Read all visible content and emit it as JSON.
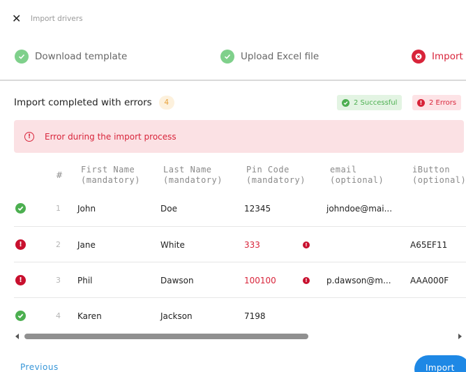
{
  "header": {
    "close_icon": "close-icon",
    "title": "Import drivers"
  },
  "steps": [
    {
      "label": "Download template",
      "state": "done",
      "icon": "check-circle-icon"
    },
    {
      "label": "Upload Excel file",
      "state": "done",
      "icon": "check-circle-icon"
    },
    {
      "label": "Import",
      "state": "error",
      "icon": "error-circle-icon"
    }
  ],
  "summary": {
    "title": "Import completed with errors",
    "count": "4",
    "success_label": "2 Successful",
    "errors_label": "2 Errors"
  },
  "alert": {
    "message": "Error during the import process",
    "icon": "error-outline-icon"
  },
  "table": {
    "columns": [
      {
        "line1": "#",
        "line2": ""
      },
      {
        "line1": "First Name",
        "line2": "(mandatory)"
      },
      {
        "line1": "Last Name",
        "line2": "(mandatory)"
      },
      {
        "line1": "Pin Code",
        "line2": "(mandatory)"
      },
      {
        "line1": "email",
        "line2": "(optional)"
      },
      {
        "line1": "iButton",
        "line2": "(optional)"
      }
    ],
    "rows": [
      {
        "status": "ok",
        "num": "1",
        "first": "John",
        "last": "Doe",
        "pin": "12345",
        "pin_error": false,
        "email": "johndoe@mai...",
        "ibutton": ""
      },
      {
        "status": "error",
        "num": "2",
        "first": "Jane",
        "last": "White",
        "pin": "333",
        "pin_error": true,
        "email": "",
        "ibutton": "A65EF11"
      },
      {
        "status": "error",
        "num": "3",
        "first": "Phil",
        "last": "Dawson",
        "pin": "100100",
        "pin_error": true,
        "email": "p.dawson@m...",
        "ibutton": "AAA000F"
      },
      {
        "status": "ok",
        "num": "4",
        "first": "Karen",
        "last": "Jackson",
        "pin": "7198",
        "pin_error": false,
        "email": "",
        "ibutton": ""
      }
    ]
  },
  "footer": {
    "previous_label": "Previous",
    "import_label": "Import"
  },
  "colors": {
    "success": "#4caf50",
    "error": "#d8243a",
    "warning": "#e7a23c",
    "primary": "#1e88e5"
  }
}
